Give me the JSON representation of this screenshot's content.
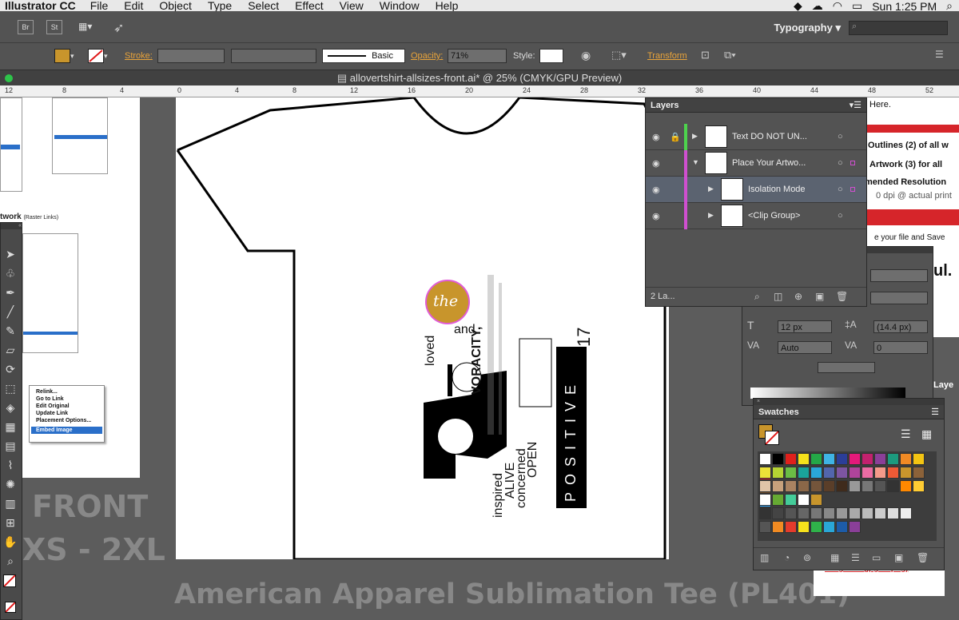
{
  "menubar": {
    "app": "Illustrator CC",
    "items": [
      "File",
      "Edit",
      "Object",
      "Type",
      "Select",
      "Effect",
      "View",
      "Window",
      "Help"
    ],
    "clock": "Sun 1:25 PM"
  },
  "appbar": {
    "br": "Br",
    "st": "St",
    "workspace": "Typography"
  },
  "controlbar": {
    "stroke_label": "Stroke:",
    "brush_label": "Basic",
    "opacity_label": "Opacity:",
    "opacity_value": "71%",
    "style_label": "Style:",
    "transform_label": "Transform",
    "fill_color": "#c8952c"
  },
  "document": {
    "tab_title": "allovertshirt-allsizes-front.ai* @ 25% (CMYK/GPU Preview)"
  },
  "ruler_ticks": [
    "12",
    "8",
    "4",
    "0",
    "4",
    "8",
    "12",
    "16",
    "20",
    "24",
    "28",
    "32",
    "36",
    "40",
    "44",
    "48",
    "52"
  ],
  "artboard_labels": {
    "front": "FRONT",
    "sizes": "XS - 2XL",
    "product": "American Apparel Sublimation Tee (PL401)"
  },
  "left_doc": {
    "artwork_label": "twork",
    "raster_links": "(Raster Links)",
    "menu_items": [
      "Relink...",
      "Go to Link",
      "Edit Original",
      "Update Link",
      "Placement Options...",
      "Embed Image"
    ]
  },
  "right_doc": {
    "lines": [
      "Here.",
      "Outlines (2) of all w",
      "Artwork (3) for all",
      "mended Resolution",
      "0 dpi @ actual print",
      "e your file and Save",
      "ul.",
      "Laye",
      "image file (jpg or png)"
    ]
  },
  "design_text": {
    "the": "the",
    "loved": "loved",
    "and": "and",
    "inspired": "inspired",
    "alive": "ALIVE",
    "concerned": "concerned",
    "open": "OPEN",
    "positive": "POSITIVE",
    "voracity": "VORACITY,",
    "number": "17"
  },
  "layers_panel": {
    "title": "Layers",
    "rows": [
      {
        "name": "Text DO NOT UN...",
        "color": "#4dd34d"
      },
      {
        "name": "Place Your Artwo...",
        "color": "#d04fd0"
      },
      {
        "name": "Isolation Mode",
        "color": "#d04fd0"
      },
      {
        "name": "<Clip Group>",
        "color": "#d04fd0"
      }
    ],
    "footer": "2 La..."
  },
  "character_panel": {
    "font_size": "12 px",
    "leading": "(14.4 px)",
    "kerning": "Auto",
    "tracking": "0"
  },
  "swatches_panel": {
    "title": "Swatches"
  }
}
